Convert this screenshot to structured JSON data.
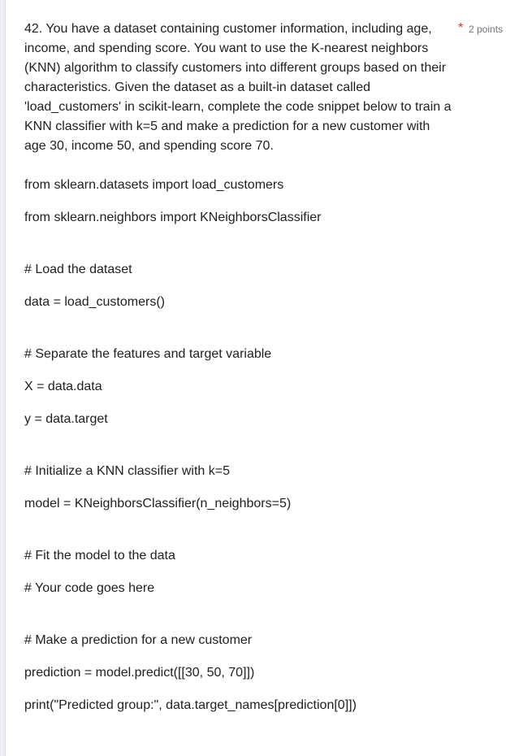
{
  "question": {
    "text": "42. You have a dataset containing customer information, including age, income, and spending score. You want to use the K-nearest neighbors (KNN) algorithm to classify customers into different groups based on their characteristics. Given the dataset as a built-in dataset called 'load_customers' in scikit-learn, complete the code snippet below to train a KNN classifier with k=5 and make a prediction for a new customer with age 30, income 50, and spending score 70.",
    "required_marker": "*",
    "points": "2 points"
  },
  "code_lines": [
    "from sklearn.datasets import load_customers",
    "from sklearn.neighbors import KNeighborsClassifier",
    "# Load the dataset",
    "data = load_customers()",
    "# Separate the features and target variable",
    "X = data.data",
    "y = data.target",
    "# Initialize a KNN classifier with k=5",
    "model = KNeighborsClassifier(n_neighbors=5)",
    "# Fit the model to the data",
    "# Your code goes here",
    "# Make a prediction for a new customer",
    "prediction = model.predict([[30, 50, 70]])",
    "print(\"Predicted group:\", data.target_names[prediction[0]])"
  ]
}
